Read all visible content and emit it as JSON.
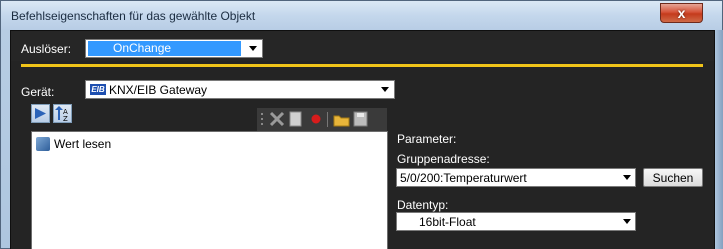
{
  "window": {
    "title": "Befehlseigenschaften für das gewählte Objekt",
    "close_label": "x"
  },
  "trigger": {
    "label": "Auslöser:",
    "value": "OnChange"
  },
  "device": {
    "label": "Gerät:",
    "badge": "EIB",
    "value": "KNX/EIB Gateway"
  },
  "commands": {
    "items": [
      "Wert lesen"
    ]
  },
  "parameters": {
    "title": "Parameter:",
    "group_address_label": "Gruppenadresse:",
    "group_address_value": "5/0/200:Temperaturwert",
    "search_label": "Suchen",
    "datatype_label": "Datentyp:",
    "datatype_value": "16bit-Float"
  },
  "colors": {
    "accent_line": "#f0c419",
    "selection": "#3399ff",
    "client_bg": "#242424"
  }
}
